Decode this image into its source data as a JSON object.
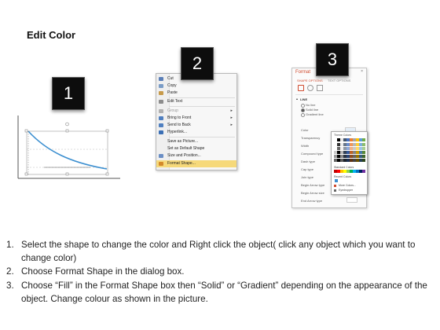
{
  "title": "Edit Color",
  "badges": [
    "1",
    "2",
    "3"
  ],
  "context_menu": {
    "items": [
      {
        "label": "Cut",
        "icon": "scissors-icon",
        "color": "#5b7fb8"
      },
      {
        "label": "Copy",
        "icon": "copy-icon",
        "color": "#7a9cc7"
      },
      {
        "label": "Paste",
        "icon": "paste-icon",
        "color": "#c79a4a"
      },
      {
        "label": "Edit Text",
        "icon": "edit-text-icon",
        "color": "#8c8c8c"
      },
      {
        "label": "Group",
        "icon": "group-icon",
        "color": "#b0b0b0",
        "dim": true,
        "arrow": true
      },
      {
        "label": "Bring to Front",
        "icon": "bring-to-front-icon",
        "color": "#4f7fc0",
        "arrow": true
      },
      {
        "label": "Send to Back",
        "icon": "send-to-back-icon",
        "color": "#4f7fc0",
        "arrow": true
      },
      {
        "label": "Hyperlink...",
        "icon": "hyperlink-icon",
        "color": "#3a6fb5"
      },
      {
        "label": "Save as Picture...",
        "icon": "",
        "color": ""
      },
      {
        "label": "Set as Default Shape",
        "icon": "",
        "color": ""
      },
      {
        "label": "Size and Position...",
        "icon": "size-position-icon",
        "color": "#6a8ec5"
      },
      {
        "label": "Format Shape...",
        "icon": "format-shape-icon",
        "color": "#d48a2a",
        "highlight": true
      }
    ]
  },
  "format_pane": {
    "title": "Format",
    "tabs": [
      "SHAPE OPTIONS",
      "TEXT OPTIONS"
    ],
    "section": "LINE",
    "options": [
      "No line",
      "Solid line",
      "Gradient line"
    ],
    "fields": [
      "Color",
      "Transparency",
      "Width",
      "Compound type",
      "Dash type",
      "Cap type",
      "Join type",
      "Begin Arrow type",
      "Begin Arrow size",
      "End Arrow type"
    ],
    "popup": {
      "theme_label": "Theme Colors",
      "standard_label": "Standard Colors",
      "recent_label": "Recent Colors",
      "more_label": "More Colors...",
      "eyedropper_label": "Eyedropper"
    },
    "accent": "#d04a2e"
  },
  "steps": [
    {
      "num": "1.",
      "text": "Select the shape to change the color and Right click the object( click any object which you want to change color)"
    },
    {
      "num": "2.",
      "text": "Choose Format Shape in the dialog box."
    },
    {
      "num": "3.",
      "text": "Choose “Fill” in the Format Shape box then “Solid” or “Gradient” depending on the appearance of the object. Change colour as shown in the picture."
    }
  ]
}
